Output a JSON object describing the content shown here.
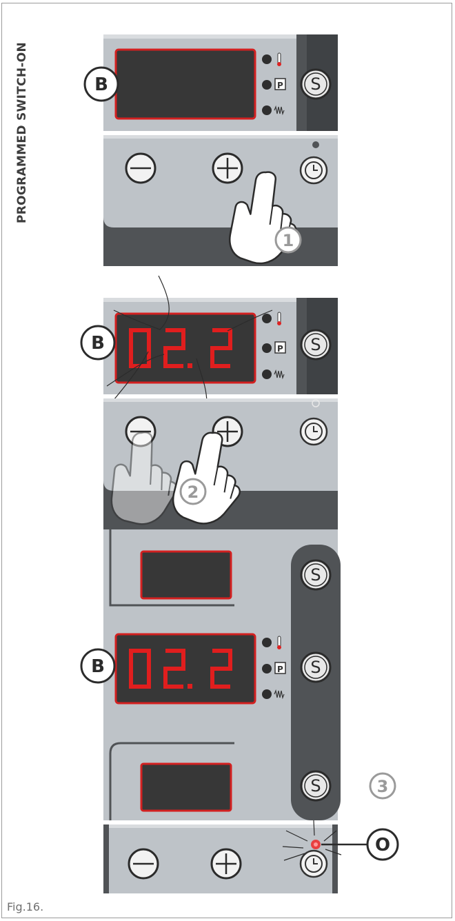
{
  "section_title": "PROGRAMMED SWITCH-ON",
  "figure_caption": "Fig.16.",
  "callouts": {
    "display_label": "B",
    "indicator_label": "O",
    "step1": "1",
    "step2": "2",
    "step3": "3"
  },
  "buttons": {
    "minus": "−",
    "plus": "+",
    "select": "S",
    "timer": "clock-icon"
  },
  "status_leds": [
    "thermometer-icon",
    "program-icon",
    "heating-icon"
  ],
  "display_readings": {
    "panel1": "",
    "panel2": "02.2",
    "panel3": "02.2"
  },
  "colors": {
    "panel_gray": "#bec3c8",
    "dark_strip": "#505356",
    "display_red": "#e01e1e",
    "display_bg": "#373737",
    "led_red": "#e03030",
    "callout_gray": "#9a9a9a"
  }
}
